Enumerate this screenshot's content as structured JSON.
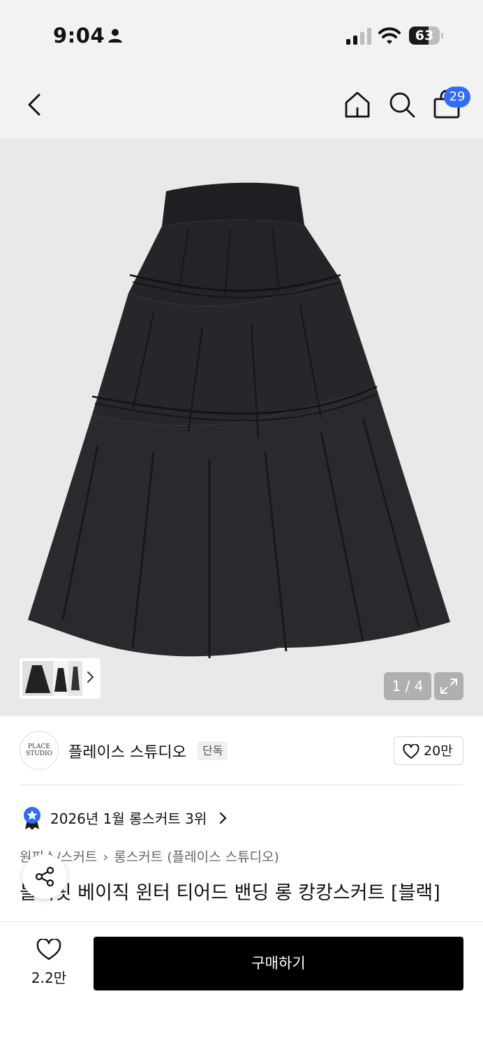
{
  "status_bar": {
    "time": "9:04",
    "battery": "63",
    "battery_level": 0.63
  },
  "header": {
    "cart_count": "29"
  },
  "gallery": {
    "counter": "1 / 4"
  },
  "brand": {
    "name": "플레이스 스튜디오",
    "tag": "단독",
    "likes": "20만",
    "logo_text": "PLACE STUDIO"
  },
  "ranking": {
    "text": "2026년 1월 롱스커트 3위"
  },
  "breadcrumb": {
    "level1": "원피스/스커트",
    "separator": "›",
    "level2": "롱스커트 (플레이스 스튜디오)"
  },
  "product": {
    "title": "블랙핏 베이직 윈터 티어드 밴딩 롱 캉캉스커트 [블랙]"
  },
  "bottom_bar": {
    "wish_count": "2.2만",
    "buy_label": "구매하기"
  },
  "colors": {
    "accent": "#2f6df6",
    "buy_button": "#000000"
  }
}
